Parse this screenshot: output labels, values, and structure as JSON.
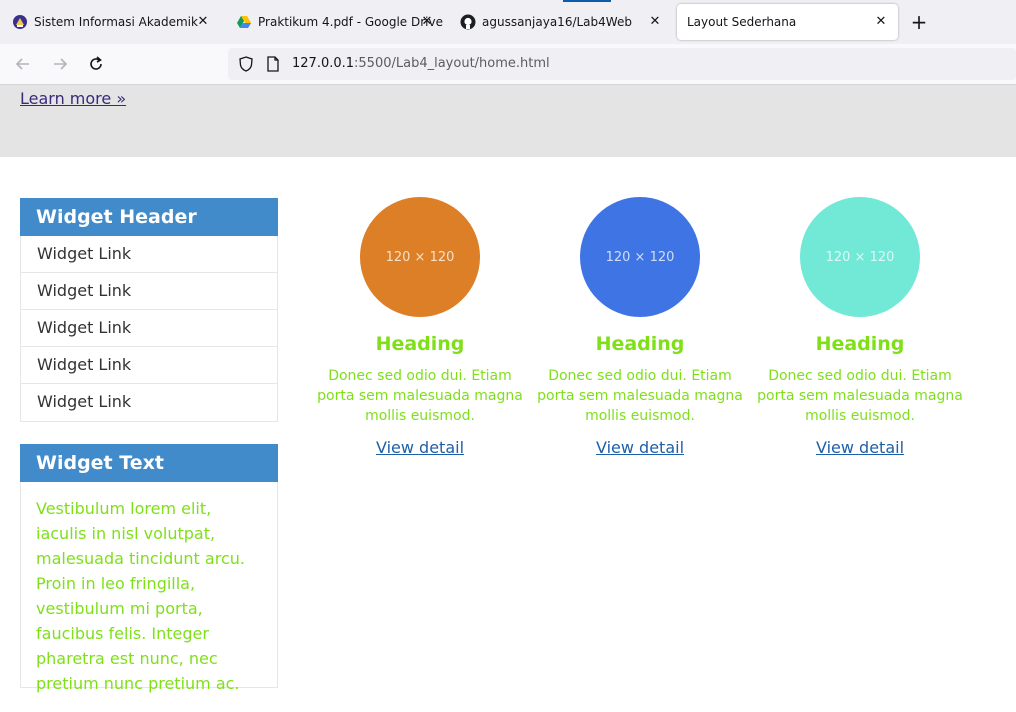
{
  "browser": {
    "tabs": [
      {
        "title": "Sistem Informasi Akademik",
        "icon": "university-icon"
      },
      {
        "title": "Praktikum 4.pdf - Google Drive",
        "icon": "google-drive-icon"
      },
      {
        "title": "agussanjaya16/Lab4Web",
        "icon": "github-icon"
      },
      {
        "title": "Layout Sederhana",
        "icon": "none"
      }
    ],
    "new_tab": "+",
    "close_glyph": "✕",
    "url_host": "127.0.0.1",
    "url_rest": ":5500/Lab4_layout/home.html"
  },
  "page": {
    "learn_more": "Learn more »",
    "sidebar": {
      "header": "Widget Header",
      "links": [
        "Widget Link",
        "Widget Link",
        "Widget Link",
        "Widget Link",
        "Widget Link"
      ],
      "text_header": "Widget Text",
      "text_body": "Vestibulum lorem elit, iaculis in nisl volutpat, malesuada tincidunt arcu. Proin in leo fringilla, vestibulum mi porta, faucibus felis. Integer pharetra est nunc, nec pretium nunc pretium ac."
    },
    "features": [
      {
        "placeholder": "120 × 120",
        "color": "#dd7f26",
        "heading": "Heading",
        "text": "Donec sed odio dui. Etiam porta sem malesuada magna mollis euismod.",
        "link": "View detail"
      },
      {
        "placeholder": "120 × 120",
        "color": "#3e74e4",
        "heading": "Heading",
        "text": "Donec sed odio dui. Etiam porta sem malesuada magna mollis euismod.",
        "link": "View detail"
      },
      {
        "placeholder": "120 × 120",
        "color": "#72e8d6",
        "heading": "Heading",
        "text": "Donec sed odio dui. Etiam porta sem malesuada magna mollis euismod.",
        "link": "View detail"
      }
    ],
    "colors": {
      "accent": "#428bca",
      "text_green": "#7fe01a",
      "link": "#1d5fa8"
    }
  }
}
